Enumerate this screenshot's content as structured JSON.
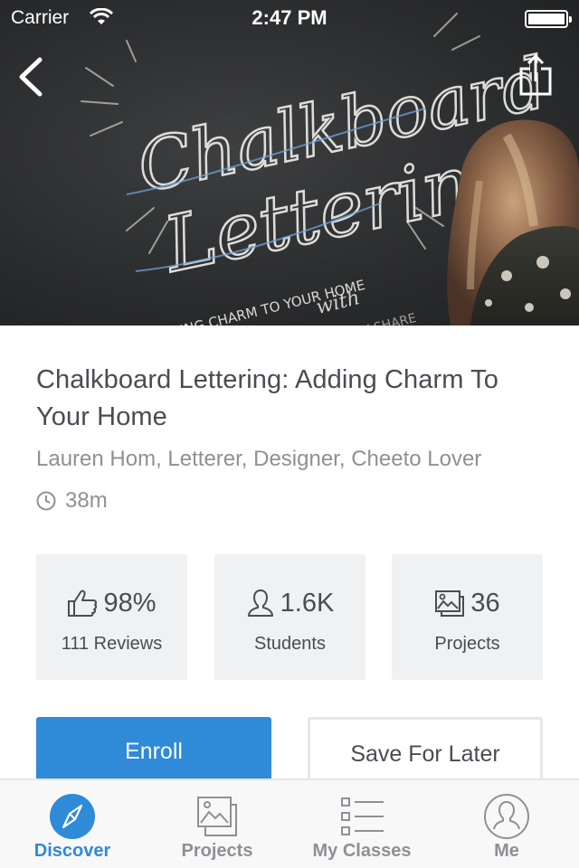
{
  "status_bar": {
    "carrier": "Carrier",
    "time": "2:47 PM"
  },
  "hero": {
    "artwork_lettering": {
      "line1": "Chalkboard",
      "line2": "Lettering",
      "tagline": "ADDING CHARM TO YOUR HOME",
      "with": "with",
      "brand": "SKILLSHARE"
    }
  },
  "course": {
    "title": "Chalkboard Lettering: Adding Charm To Your Home",
    "teacher": "Lauren Hom, Letterer, Designer, Cheeto Lover",
    "duration": "38m"
  },
  "stats": [
    {
      "icon": "thumbs-up-icon",
      "value": "98%",
      "label": "111 Reviews"
    },
    {
      "icon": "person-icon",
      "value": "1.6K",
      "label": "Students"
    },
    {
      "icon": "gallery-icon",
      "value": "36",
      "label": "Projects"
    }
  ],
  "actions": {
    "enroll_label": "Enroll",
    "save_label": "Save For Later"
  },
  "tabbar": {
    "tabs": [
      {
        "label": "Discover",
        "icon": "compass-icon",
        "active": true
      },
      {
        "label": "Projects",
        "icon": "gallery-icon",
        "active": false
      },
      {
        "label": "My Classes",
        "icon": "list-icon",
        "active": false
      },
      {
        "label": "Me",
        "icon": "profile-icon",
        "active": false
      }
    ]
  },
  "colors": {
    "accent": "#2f8ad8",
    "text": "#4a4c53",
    "muted": "#8e9095",
    "stat_bg": "#f0f1f2"
  }
}
